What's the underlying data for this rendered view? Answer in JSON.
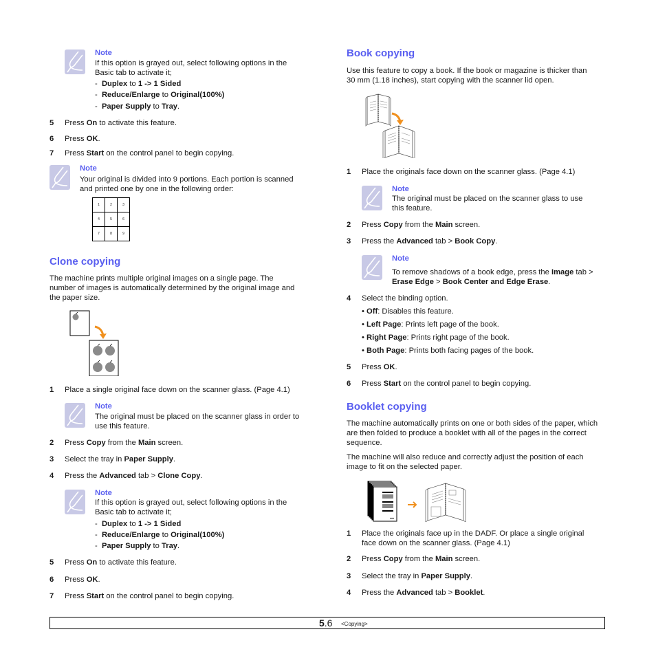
{
  "left": {
    "note1": {
      "title": "Note",
      "lines": [
        "If this option is grayed out, select following options in the",
        "Basic tab to activate it;"
      ],
      "items": [
        {
          "b1": "Duplex",
          "t1": " to ",
          "b2": "1 -> 1 Sided",
          "t2": ""
        },
        {
          "b1": "Reduce/Enlarge",
          "t1": " to ",
          "b2": "Original(100%)",
          "t2": ""
        },
        {
          "b1": "Paper Supply",
          "t1": " to ",
          "b2": "Tray",
          "t2": "."
        }
      ]
    },
    "steps_a": [
      {
        "num": "5",
        "pre": "Press ",
        "b": "On",
        "post": " to activate this feature."
      },
      {
        "num": "6",
        "pre": "Press ",
        "b": "OK",
        "post": "."
      },
      {
        "num": "7",
        "pre": "Press ",
        "b": "Start",
        "post": " on the control panel to begin copying."
      }
    ],
    "note2": {
      "title": "Note",
      "lines": [
        "Your original is divided into 9 portions. Each portion is scanned",
        "and printed one by one in the following order:"
      ],
      "grid": [
        [
          "1",
          "2",
          "3"
        ],
        [
          "4",
          "5",
          "6"
        ],
        [
          "7",
          "8",
          "9"
        ]
      ]
    },
    "clone": {
      "heading": "Clone copying",
      "intro": [
        "The machine prints multiple original images on a single page. The",
        "number of images is automatically determined by the original image and",
        "the paper size."
      ],
      "step1": {
        "num": "1",
        "text": "Place a single original face down on the scanner glass. (Page 4.1)"
      },
      "note": {
        "title": "Note",
        "lines": [
          "The original must be placed on the scanner glass in order to",
          "use this feature."
        ]
      },
      "step2": {
        "num": "2",
        "pre": "Press ",
        "b1": "Copy",
        "mid": " from the ",
        "b2": "Main",
        "post": " screen."
      },
      "step3": {
        "num": "3",
        "pre": "Select the tray in ",
        "b1": "Paper Supply",
        "post": "."
      },
      "step4": {
        "num": "4",
        "pre": "Press the ",
        "b1": "Advanced",
        "mid": " tab > ",
        "b2": "Clone Copy",
        "post": "."
      },
      "note2": {
        "title": "Note",
        "lines": [
          "If this option is grayed out, select following options in the",
          "Basic tab to activate it;"
        ],
        "items": [
          {
            "b1": "Duplex",
            "t1": " to ",
            "b2": "1 -> 1 Sided",
            "t2": ""
          },
          {
            "b1": "Reduce/Enlarge",
            "t1": " to ",
            "b2": "Original(100%)",
            "t2": ""
          },
          {
            "b1": "Paper Supply",
            "t1": " to ",
            "b2": "Tray",
            "t2": "."
          }
        ]
      },
      "steps_b": [
        {
          "num": "5",
          "pre": "Press ",
          "b": "On",
          "post": " to activate this feature."
        },
        {
          "num": "6",
          "pre": "Press ",
          "b": "OK",
          "post": "."
        },
        {
          "num": "7",
          "pre": "Press ",
          "b": "Start",
          "post": " on the control panel to begin copying."
        }
      ]
    }
  },
  "right": {
    "book": {
      "heading": "Book copying",
      "intro": [
        "Use this feature to copy a book. If the book or magazine is thicker than",
        "30 mm (1.18 inches), start copying with the scanner lid open."
      ],
      "step1": {
        "num": "1",
        "text": "Place the originals face down on the scanner glass. (Page 4.1)"
      },
      "note1": {
        "title": "Note",
        "lines": [
          "The original must be placed on the scanner glass to use",
          "this feature."
        ]
      },
      "step2": {
        "num": "2",
        "pre": "Press ",
        "b1": "Copy",
        "mid": " from the ",
        "b2": "Main",
        "post": " screen."
      },
      "step3": {
        "num": "3",
        "pre": "Press the ",
        "b1": "Advanced",
        "mid": " tab > ",
        "b2": "Book Copy",
        "post": "."
      },
      "note2": {
        "title": "Note",
        "l1_pre": "To remove shadows of a book edge, press the ",
        "l1_b": "Image",
        "l1_post": " tab >",
        "l2_b1": "Erase Edge",
        "l2_mid": " > ",
        "l2_b2": "Book Center and Edge Erase",
        "l2_post": "."
      },
      "step4": {
        "num": "4",
        "text": "Select the binding option."
      },
      "bullets": [
        {
          "b": "Off",
          "t": ": Disables this feature."
        },
        {
          "b": "Left Page",
          "t": ": Prints left page of the book."
        },
        {
          "b": "Right Page",
          "t": ": Prints right page of the book."
        },
        {
          "b": "Both Page",
          "t": ": Prints both facing pages of the book."
        }
      ],
      "step5": {
        "num": "5",
        "pre": "Press ",
        "b": "OK",
        "post": "."
      },
      "step6": {
        "num": "6",
        "pre": "Press ",
        "b": "Start",
        "post": " on the control panel to begin copying."
      }
    },
    "booklet": {
      "heading": "Booklet copying",
      "intro1": [
        "The machine automatically prints on one or both sides of the paper, which",
        "are then folded to produce a booklet with all of the pages in the correct",
        "sequence."
      ],
      "intro2": [
        "The machine will also reduce and correctly adjust the position of each",
        "image to fit on the selected paper."
      ],
      "step1": {
        "num": "1",
        "lines": [
          "Place the originals face up in the DADF. Or place a single original",
          "face down on the scanner glass. (Page 4.1)"
        ]
      },
      "step2": {
        "num": "2",
        "pre": "Press ",
        "b1": "Copy",
        "mid": " from the ",
        "b2": "Main",
        "post": " screen."
      },
      "step3": {
        "num": "3",
        "pre": "Select the tray in ",
        "b1": "Paper Supply",
        "post": "."
      },
      "step4": {
        "num": "4",
        "pre": "Press the ",
        "b1": "Advanced",
        "mid": " tab > ",
        "b2": "Booklet",
        "post": "."
      }
    }
  },
  "footer": {
    "major": "5",
    "minor": ".6",
    "section": "<Copying>"
  },
  "colors": {
    "heading": "#5a5ff0",
    "note_icon": "#c8c9e6",
    "arrow": "#f0901e"
  }
}
